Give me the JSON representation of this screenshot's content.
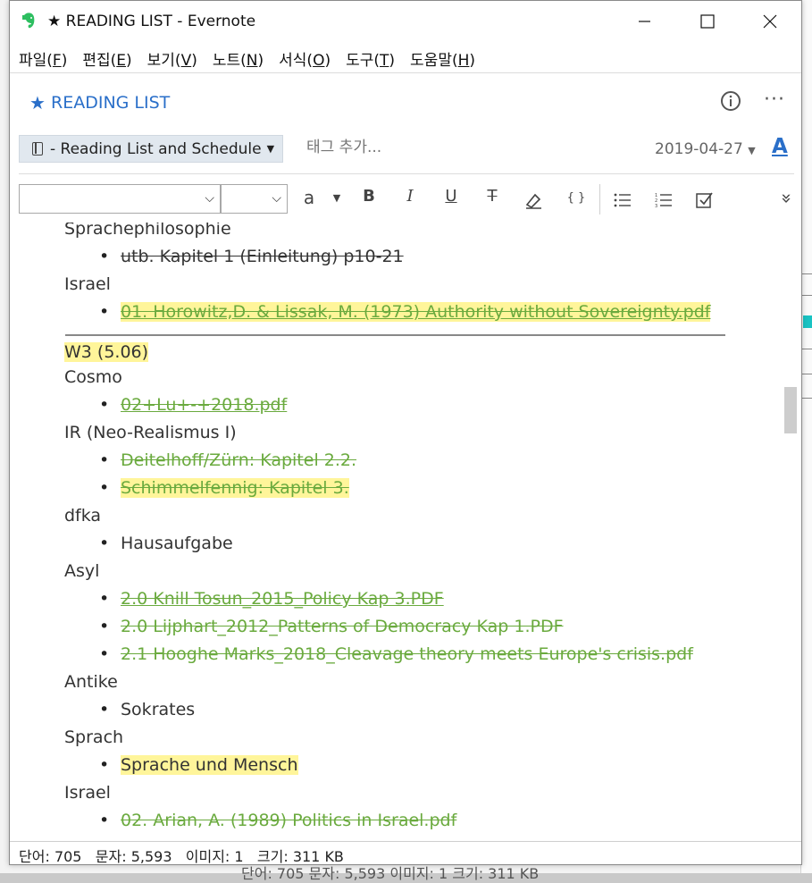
{
  "window": {
    "title": "★ READING LIST - Evernote",
    "controls": {
      "minimize": "—",
      "maximize": "☐",
      "close": "✕"
    }
  },
  "menu": [
    {
      "label": "파일(",
      "key": "F",
      "suffix": ")"
    },
    {
      "label": "편집(",
      "key": "E",
      "suffix": ")"
    },
    {
      "label": "보기(",
      "key": "V",
      "suffix": ")"
    },
    {
      "label": "노트(",
      "key": "N",
      "suffix": ")"
    },
    {
      "label": "서식(",
      "key": "O",
      "suffix": ")"
    },
    {
      "label": "도구(",
      "key": "T",
      "suffix": ")"
    },
    {
      "label": "도움말(",
      "key": "H",
      "suffix": ")"
    }
  ],
  "note": {
    "star": "★",
    "title": "READING LIST",
    "notebook": "- Reading List and Schedule",
    "tag_placeholder": "태그 추가...",
    "date": "2019-04-27",
    "font_button": "A",
    "more": "···"
  },
  "toolbar": {
    "font_family": "",
    "font_size": "",
    "text_color": "a",
    "bold": "B",
    "italic": "I",
    "underline": "U",
    "strikethrough": "T",
    "code": "{ }",
    "expand": "»"
  },
  "content": {
    "lines": [
      {
        "kind": "heading",
        "text": "Sprachephilosophie"
      },
      {
        "kind": "bullet",
        "text": "utb. Kapitel 1 (Einleitung) p10-21"
      },
      {
        "kind": "heading",
        "text": "Israel"
      },
      {
        "kind": "bullet",
        "text": "01. Horowitz,D. & Lissak, M. (1973) Authority without Sovereignty.pdf"
      },
      {
        "kind": "heading",
        "text": "W3 (5.06)"
      },
      {
        "kind": "heading",
        "text": "Cosmo"
      },
      {
        "kind": "bullet",
        "text": "02+Lu+-+2018.pdf"
      },
      {
        "kind": "heading",
        "text": "IR (Neo-Realismus I)"
      },
      {
        "kind": "bullet",
        "text": "Deitelhoff/Zürn: Kapitel 2.2."
      },
      {
        "kind": "bullet",
        "text": "Schimmelfennig: Kapitel 3."
      },
      {
        "kind": "heading",
        "text": "dfka"
      },
      {
        "kind": "bullet",
        "text": "Hausaufgabe"
      },
      {
        "kind": "heading",
        "text": "Asyl"
      },
      {
        "kind": "bullet",
        "text": "2.0 Knill Tosun_2015_Policy Kap 3.PDF"
      },
      {
        "kind": "bullet",
        "text": "2.0 Lijphart_2012_Patterns of Democracy Kap 1.PDF"
      },
      {
        "kind": "bullet",
        "text": "2.1 Hooghe Marks_2018_Cleavage theory meets Europe's crisis.pdf"
      },
      {
        "kind": "heading",
        "text": "Antike"
      },
      {
        "kind": "bullet",
        "text": "Sokrates"
      },
      {
        "kind": "heading",
        "text": "Sprach"
      },
      {
        "kind": "bullet",
        "text": "Sprache und Mensch"
      },
      {
        "kind": "heading",
        "text": "Israel"
      },
      {
        "kind": "bullet",
        "text": "02. Arian, A. (1989) Politics in Israel.pdf"
      }
    ]
  },
  "status": {
    "words_label": "단어:",
    "words": "705",
    "chars_label": "문자:",
    "chars": "5,593",
    "images_label": "이미지:",
    "images": "1",
    "size_label": "크기:",
    "size": "311 KB"
  },
  "background_status": "단어: 705   문자: 5,593   이미지: 1   크기: 311 KB",
  "colors": {
    "accent": "#2a6fc9",
    "link_green": "#6aaa3e",
    "highlight": "#fff59a"
  }
}
